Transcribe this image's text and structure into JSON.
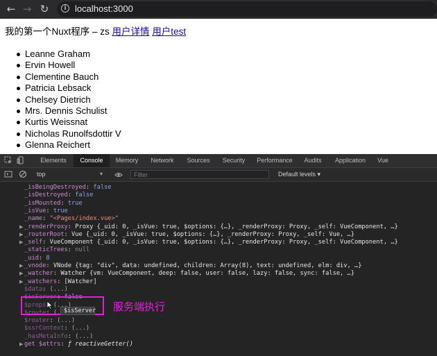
{
  "browser": {
    "back_icon": "arrow-left-icon",
    "forward_icon": "arrow-right-icon",
    "reload_icon": "reload-icon",
    "info_icon": "info-icon",
    "url": "localhost:3000"
  },
  "page": {
    "header_text": "我的第一个Nuxt程序 – zs",
    "links": [
      "用户详情",
      "用户test"
    ],
    "users": [
      "Leanne Graham",
      "Ervin Howell",
      "Clementine Bauch",
      "Patricia Lebsack",
      "Chelsey Dietrich",
      "Mrs. Dennis Schulist",
      "Kurtis Weissnat",
      "Nicholas Runolfsdottir V",
      "Glenna Reichert"
    ]
  },
  "devtools": {
    "tabs": [
      "Elements",
      "Console",
      "Memory",
      "Network",
      "Sources",
      "Security",
      "Performance",
      "Audits",
      "Application",
      "Vue"
    ],
    "active_tab": "Console",
    "context": "top",
    "filter_placeholder": "Filter",
    "levels": "Default levels ▾"
  },
  "console_lines": [
    {
      "indent": 0,
      "arrow": false,
      "key": "_isBeingDestroyed",
      "value": "false",
      "type": "bool"
    },
    {
      "indent": 0,
      "arrow": false,
      "key": "_isDestroyed",
      "value": "false",
      "type": "bool"
    },
    {
      "indent": 0,
      "arrow": false,
      "key": "_isMounted",
      "value": "true",
      "type": "bool"
    },
    {
      "indent": 0,
      "arrow": false,
      "key": "_isVue",
      "value": "true",
      "type": "bool"
    },
    {
      "indent": 0,
      "arrow": false,
      "key": "_name",
      "value": "\"<Pages/index.vue>\"",
      "type": "str"
    },
    {
      "indent": 0,
      "arrow": true,
      "key": "_renderProxy",
      "value": "Proxy {_uid: 0, _isVue: true, $options: {…}, _renderProxy: Proxy, _self: VueComponent, …}",
      "type": "obj"
    },
    {
      "indent": 0,
      "arrow": true,
      "key": "_routerRoot",
      "value": "Vue {_uid: 0, _isVue: true, $options: {…}, _renderProxy: Proxy, _self: Vue, …}",
      "type": "obj"
    },
    {
      "indent": 0,
      "arrow": true,
      "key": "_self",
      "value": "VueComponent {_uid: 0, _isVue: true, $options: {…}, _renderProxy: Proxy, _self: VueComponent, …}",
      "type": "obj"
    },
    {
      "indent": 0,
      "arrow": false,
      "key": "_staticTrees",
      "value": "null",
      "type": "null"
    },
    {
      "indent": 0,
      "arrow": false,
      "key": "_uid",
      "value": "8",
      "type": "num"
    },
    {
      "indent": 0,
      "arrow": true,
      "key": "_vnode",
      "value": "VNode {tag: \"div\", data: undefined, children: Array(8), text: undefined, elm: div, …}",
      "type": "obj"
    },
    {
      "indent": 0,
      "arrow": true,
      "key": "_watcher",
      "value": "Watcher {vm: VueComponent, deep: false, user: false, lazy: false, sync: false, …}",
      "type": "obj"
    },
    {
      "indent": 0,
      "arrow": true,
      "key": "_watchers",
      "value": "[Watcher]",
      "type": "obj"
    },
    {
      "indent": 0,
      "arrow": false,
      "key": "$data",
      "value": "(...)",
      "type": "obj",
      "dim": true
    },
    {
      "indent": 0,
      "arrow": false,
      "key": "$isServer",
      "value": "false",
      "type": "bool",
      "dim": true
    },
    {
      "indent": 0,
      "arrow": false,
      "key": "$props",
      "value": "(...)",
      "type": "obj",
      "dim": true
    },
    {
      "indent": 0,
      "arrow": false,
      "key": "$route",
      "value": "(...)",
      "type": "obj",
      "dim": true
    },
    {
      "indent": 0,
      "arrow": false,
      "key": "$router",
      "value": "(...)",
      "type": "obj",
      "dim": true
    },
    {
      "indent": 0,
      "arrow": false,
      "key": "$ssrContext",
      "value": "(...)",
      "type": "obj",
      "dim": true
    },
    {
      "indent": 0,
      "arrow": false,
      "key": "_hasMetaInfo",
      "value": "(...)",
      "type": "obj",
      "dim": true
    },
    {
      "indent": 0,
      "arrow": true,
      "key": "get $attrs",
      "value": "ƒ reactiveGetter()",
      "type": "fn"
    }
  ],
  "annotation": {
    "label": "服务端执行",
    "tooltip": "$isServer",
    "color": "#e01fd8"
  }
}
